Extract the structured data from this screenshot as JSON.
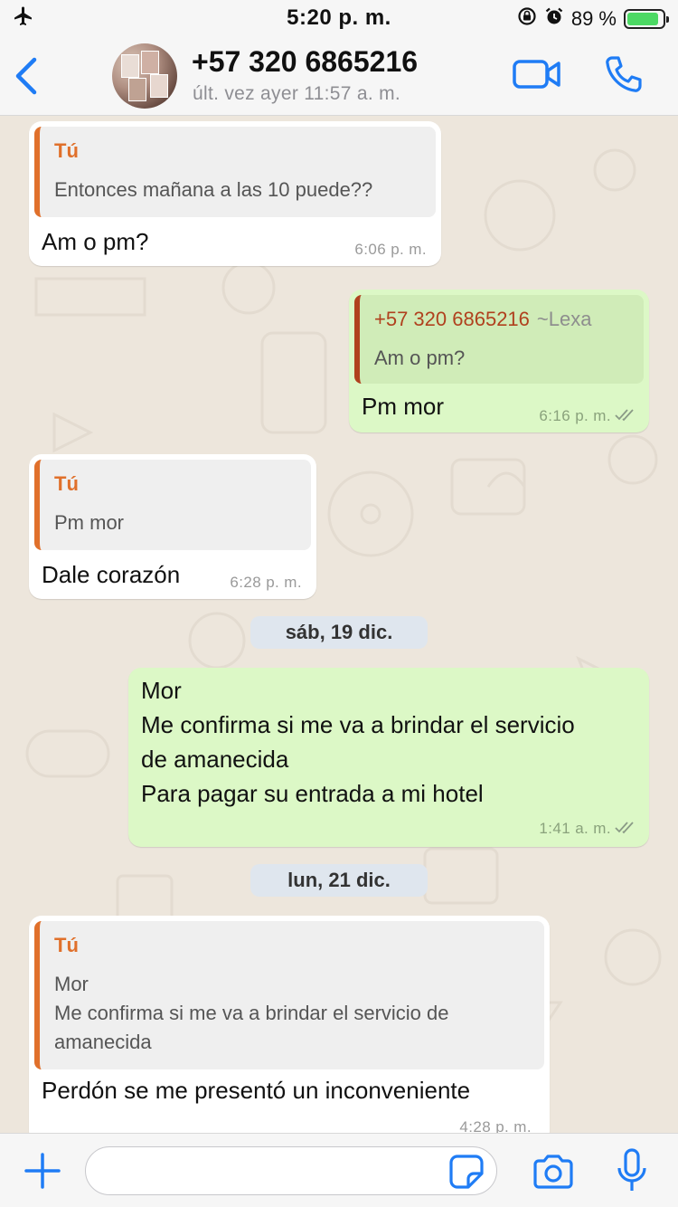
{
  "status_bar": {
    "time": "5:20 p. m.",
    "battery_percent": "89 %",
    "battery_level": 0.89
  },
  "header": {
    "contact_name": "+57 320 6865216",
    "last_seen": "últ. vez ayer 11:57 a. m."
  },
  "messages": [
    {
      "direction": "in",
      "quote_author": "Tú",
      "quote_text": "Entonces mañana a las 10 puede??",
      "text": "Am o pm?",
      "time": "6:06 p. m."
    },
    {
      "direction": "out",
      "quote_author": "+57 320 6865216",
      "quote_alias": "~Lexa",
      "quote_text": "Am o pm?",
      "text": "Pm mor",
      "time": "6:16 p. m."
    },
    {
      "direction": "in",
      "quote_author": "Tú",
      "quote_text": "Pm mor",
      "text": "Dale corazón",
      "time": "6:28 p. m."
    },
    {
      "direction": "out",
      "text": "Mor\nMe confirma si me va a brindar el servicio\nde amanecida\nPara pagar su entrada a mi hotel",
      "time": "1:41 a. m."
    },
    {
      "direction": "in",
      "quote_author": "Tú",
      "quote_text": "Mor\nMe confirma si me va a brindar el servicio de\namanecida",
      "text": "Perdón se me presentó un inconveniente",
      "time": "4:28 p. m."
    }
  ],
  "date_chips": [
    "sáb, 19 dic.",
    "lun, 21 dic."
  ],
  "input": {
    "placeholder": ""
  },
  "colors": {
    "accent": "#1f7cf5",
    "outgoing_bubble": "#dcf8c6",
    "incoming_bubble": "#ffffff",
    "quote_bar_in": "#e0702b",
    "quote_bar_out": "#b0411e",
    "read_ticks": "#8a9a86"
  },
  "icons": {
    "status_left": "airplane-icon",
    "status_right": [
      "rotation-lock-icon",
      "alarm-icon",
      "battery-charging-icon"
    ],
    "header": [
      "back-chevron-icon",
      "video-call-icon",
      "phone-icon"
    ],
    "input_bar": [
      "plus-icon",
      "sticker-icon",
      "camera-icon",
      "microphone-icon"
    ]
  }
}
